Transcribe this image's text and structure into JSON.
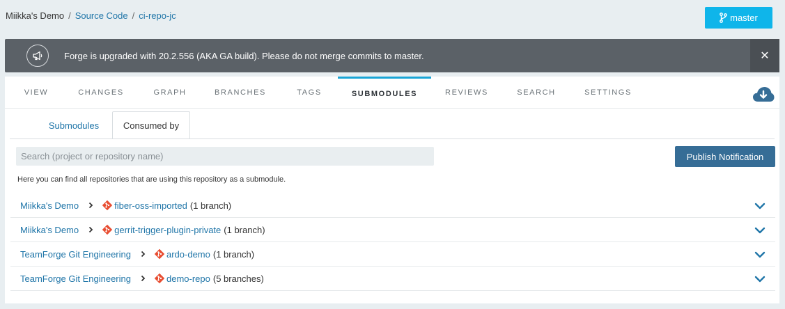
{
  "breadcrumb": {
    "project": "Miikka's Demo",
    "section": "Source Code",
    "repo": "ci-repo-jc"
  },
  "branch_button": {
    "label": "master",
    "icon": "git-branch-icon"
  },
  "banner": {
    "icon": "megaphone-icon",
    "message": "Forge is upgraded with 20.2.556 (AKA GA build). Please do not merge commits to master.",
    "close": "✕"
  },
  "tabs": [
    {
      "label": "VIEW"
    },
    {
      "label": "CHANGES"
    },
    {
      "label": "GRAPH"
    },
    {
      "label": "BRANCHES"
    },
    {
      "label": "TAGS"
    },
    {
      "label": "SUBMODULES",
      "active": true
    },
    {
      "label": "REVIEWS"
    },
    {
      "label": "SEARCH"
    },
    {
      "label": "SETTINGS"
    }
  ],
  "download_icon": "cloud-download-icon",
  "subtabs": [
    {
      "label": "Submodules"
    },
    {
      "label": "Consumed by",
      "active": true
    }
  ],
  "search": {
    "placeholder": "Search (project or repository name)",
    "value": ""
  },
  "publish_button": "Publish Notification",
  "hint": "Here you can find all repositories that are using this repository as a submodule.",
  "consumers": [
    {
      "project": "Miikka's Demo",
      "repo": "fiber-oss-imported",
      "branches": "(1 branch)"
    },
    {
      "project": "Miikka's Demo",
      "repo": "gerrit-trigger-plugin-private",
      "branches": "(1 branch)"
    },
    {
      "project": "TeamForge Git Engineering",
      "repo": "ardo-demo",
      "branches": "(1 branch)"
    },
    {
      "project": "TeamForge Git Engineering",
      "repo": "demo-repo",
      "branches": "(5 branches)"
    }
  ],
  "colors": {
    "accent": "#0fb5ea",
    "link": "#1f75a8",
    "banner": "#5b6167",
    "publish": "#366d96",
    "git": "#e84d31"
  }
}
